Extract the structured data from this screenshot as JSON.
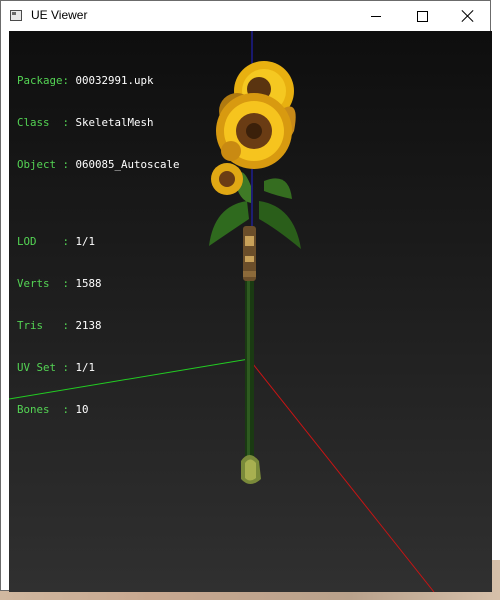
{
  "window": {
    "title": "UE Viewer",
    "icon": "app-window-icon",
    "controls": [
      "minimize-icon",
      "maximize-icon",
      "close-icon"
    ]
  },
  "info": [
    {
      "key": "Package",
      "sep": ": ",
      "value": "00032991.upk"
    },
    {
      "key": "Class  ",
      "sep": ": ",
      "value": "SkeletalMesh"
    },
    {
      "key": "Object ",
      "sep": ": ",
      "value": "060085_Autoscale"
    },
    {
      "key": "LOD    ",
      "sep": ": ",
      "value": "1/1"
    },
    {
      "key": "Verts  ",
      "sep": ": ",
      "value": "1588"
    },
    {
      "key": "Tris   ",
      "sep": ": ",
      "value": "2138"
    },
    {
      "key": "UV Set ",
      "sep": ": ",
      "value": "1/1"
    },
    {
      "key": "Bones  ",
      "sep": ": ",
      "value": "10"
    }
  ],
  "colors": {
    "label": "#54d454",
    "value": "#ffffff",
    "axis_x": "#c81414",
    "axis_y": "#22cc22",
    "axis_z": "#2222cc",
    "viewport_top": "#0e0e0e",
    "viewport_bottom": "#303030"
  }
}
